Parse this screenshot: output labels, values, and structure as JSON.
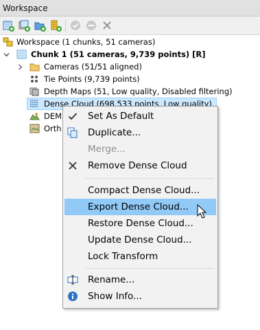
{
  "window": {
    "title": "Workspace"
  },
  "toolbar": {
    "buttons": [
      "add-chunk-icon",
      "add-photos-icon",
      "add-folder-icon",
      "add-markers-icon",
      "enable-icon",
      "disable-icon",
      "remove-icon"
    ]
  },
  "tree": {
    "workspace": "Workspace (1 chunks, 51 cameras)",
    "chunk": "Chunk 1 (51 cameras, 9,739 points) [R]",
    "cameras": "Cameras (51/51 aligned)",
    "tie_points": "Tie Points (9,739 points)",
    "depth_maps": "Depth Maps (51, Low quality, Disabled filtering)",
    "dense_cloud": "Dense Cloud (698,533 points, Low quality)",
    "dem": "DEM",
    "ortho": "Orth"
  },
  "context_menu": {
    "set_as_default": "Set As Default",
    "duplicate": "Duplicate...",
    "merge": "Merge...",
    "remove_dense_cloud": "Remove Dense Cloud",
    "compact_dense_cloud": "Compact Dense Cloud...",
    "export_dense_cloud": "Export Dense Cloud...",
    "restore_dense_cloud": "Restore Dense Cloud...",
    "update_dense_cloud": "Update Dense Cloud...",
    "lock_transform": "Lock Transform",
    "rename": "Rename...",
    "show_info": "Show Info..."
  },
  "colors": {
    "highlight": "#91c9f7",
    "selection": "#cce8ff",
    "disabled_text": "#8d8d8d"
  }
}
